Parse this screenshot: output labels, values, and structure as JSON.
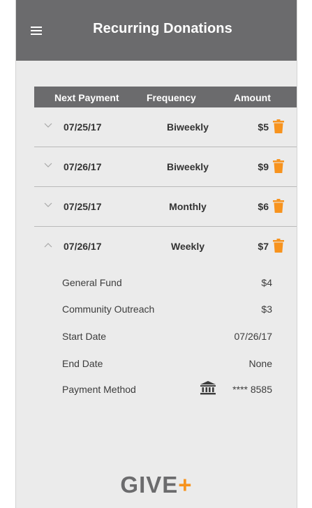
{
  "appbar": {
    "title": "Recurring Donations",
    "menu_icon": "hamburger-menu-icon"
  },
  "table": {
    "headers": {
      "next_payment": "Next Payment",
      "frequency": "Frequency",
      "amount": "Amount"
    },
    "rows": [
      {
        "date": "07/25/17",
        "frequency": "Biweekly",
        "amount": "$5",
        "expanded": false
      },
      {
        "date": "07/26/17",
        "frequency": "Biweekly",
        "amount": "$9",
        "expanded": false
      },
      {
        "date": "07/25/17",
        "frequency": "Monthly",
        "amount": "$6",
        "expanded": false
      },
      {
        "date": "07/26/17",
        "frequency": "Weekly",
        "amount": "$7",
        "expanded": true
      }
    ]
  },
  "details": {
    "general_fund": {
      "label": "General Fund",
      "value": "$4"
    },
    "community_outreach": {
      "label": "Community Outreach",
      "value": "$3"
    },
    "start_date": {
      "label": "Start Date",
      "value": "07/26/17"
    },
    "end_date": {
      "label": "End Date",
      "value": "None"
    },
    "payment_method": {
      "label": "Payment Method",
      "value": "**** 8585",
      "icon": "bank-icon"
    }
  },
  "logo": {
    "text": "GIVE",
    "plus": "+"
  },
  "colors": {
    "header": "#6b6b6d",
    "background": "#ebebeb",
    "accent": "#f7931e",
    "text": "#333333"
  }
}
